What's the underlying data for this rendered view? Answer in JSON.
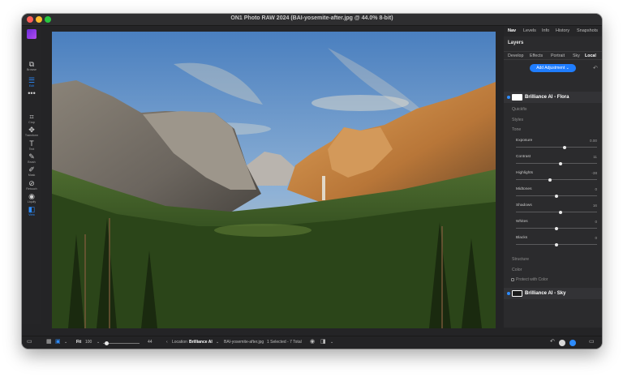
{
  "window": {
    "title": "ON1 Photo RAW 2024 (BAI-yosemite-after.jpg @ 44.0% 8-bit)"
  },
  "left_tools": [
    {
      "label": "Browse",
      "icon": "browse-icon"
    },
    {
      "label": "Edit",
      "icon": "edit-icon"
    },
    {
      "label": "Crop",
      "icon": "crop-icon"
    },
    {
      "label": "Transform",
      "icon": "transform-icon"
    },
    {
      "label": "Text",
      "icon": "text-icon"
    },
    {
      "label": "Brush",
      "icon": "brush-icon"
    },
    {
      "label": "Mask",
      "icon": "mask-icon"
    },
    {
      "label": "Retouch",
      "icon": "retouch-icon"
    },
    {
      "label": "Liquify",
      "icon": "liquify-icon"
    },
    {
      "label": "View",
      "icon": "view-icon"
    }
  ],
  "panel": {
    "nav_tabs": [
      "Nav",
      "Levels",
      "Info",
      "History",
      "Snapshots"
    ],
    "layers_title": "Layers",
    "sub_tabs": [
      "Develop",
      "Effects",
      "Portrait",
      "Sky",
      "Local"
    ],
    "add_adjustment": "Add Adjustment",
    "layer1_name": "Brilliance AI - Flora",
    "sections": {
      "quickfix": "Quickfix",
      "styles": "Styles",
      "tone": "Tone",
      "structure": "Structure",
      "color": "Color"
    },
    "sliders": [
      {
        "label": "Exposure",
        "value": "0.00",
        "pos": 0.6
      },
      {
        "label": "Contrast",
        "value": "11",
        "pos": 0.55
      },
      {
        "label": "Highlights",
        "value": "-38",
        "pos": 0.42
      },
      {
        "label": "Midtones",
        "value": "0",
        "pos": 0.5
      },
      {
        "label": "Shadows",
        "value": "16",
        "pos": 0.55
      },
      {
        "label": "Whites",
        "value": "0",
        "pos": 0.5
      },
      {
        "label": "Blacks",
        "value": "0",
        "pos": 0.5
      }
    ],
    "protect_colors": "Protect with Color",
    "layer2_name": "Brilliance AI - Sky"
  },
  "bottom": {
    "fit_label": "Fit",
    "zoom_value": "100",
    "zoom_count": "44",
    "location_label": "Location",
    "location_value": "Brilliance AI",
    "filename": "BAI-yosemite-after.jpg",
    "selection": "1 Selected - 7 Total"
  },
  "colors": {
    "accent": "#2d8cff",
    "panel_bg": "#2b2b2d",
    "button_blue": "#1f7dff"
  }
}
